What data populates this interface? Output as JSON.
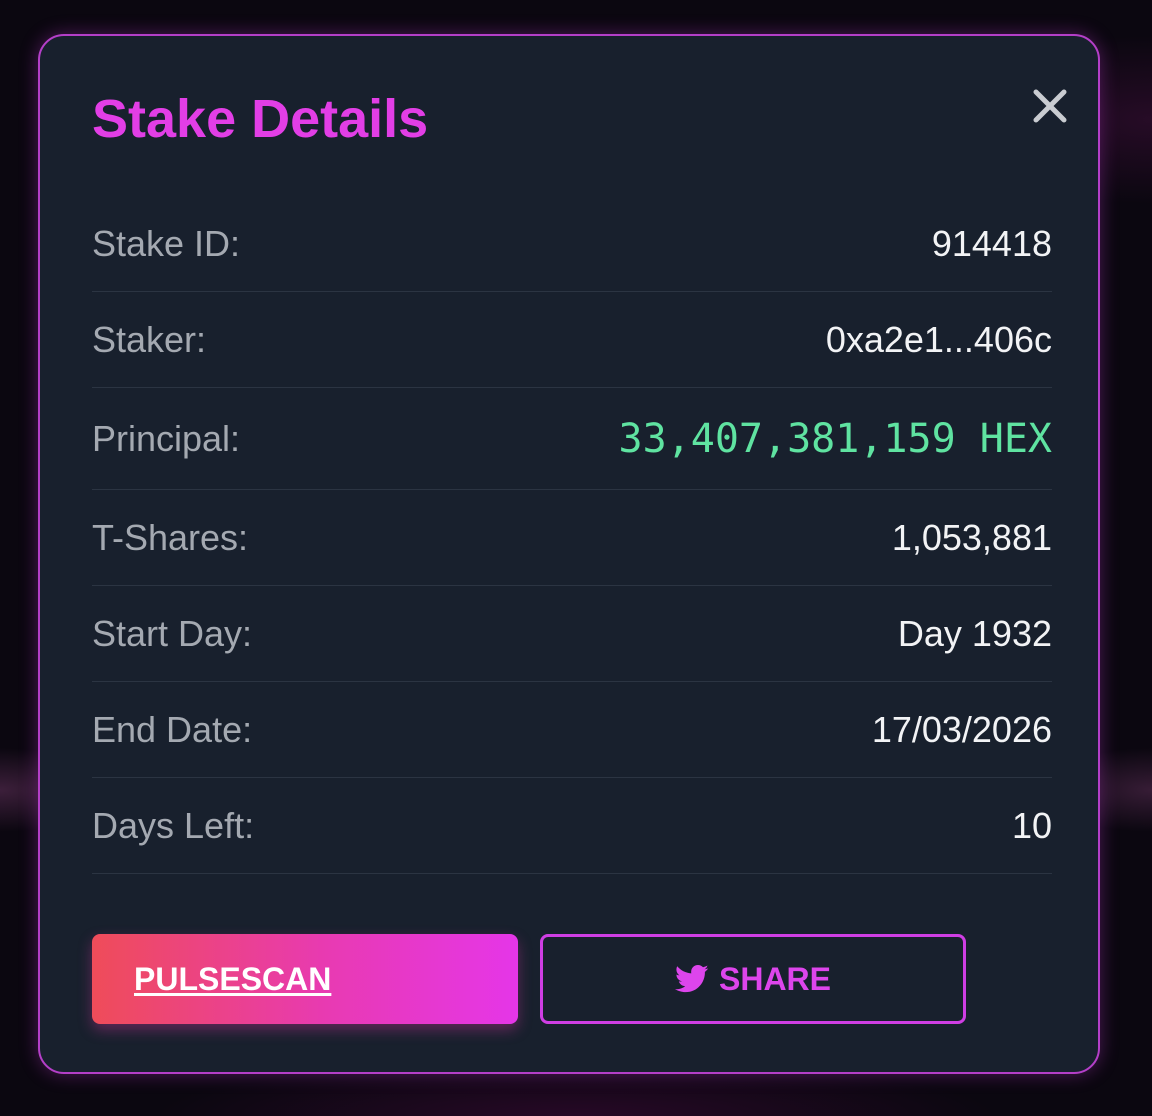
{
  "colors": {
    "accent": "#e23ee6",
    "principal_green": "#5fe3a1",
    "panel_bg": "#18202d",
    "border": "#b43fc8"
  },
  "modal": {
    "title": "Stake Details",
    "close_icon": "close-icon"
  },
  "details": [
    {
      "label": "Stake ID:",
      "value": "914418"
    },
    {
      "label": "Staker:",
      "value": "0xa2e1...406c"
    },
    {
      "label": "Principal:",
      "value": "33,407,381,159 HEX"
    },
    {
      "label": "T-Shares:",
      "value": "1,053,881"
    },
    {
      "label": "Start Day:",
      "value": "Day 1932"
    },
    {
      "label": "End Date:",
      "value": "17/03/2026"
    },
    {
      "label": "Days Left:",
      "value": "10"
    }
  ],
  "actions": {
    "pulsescan_label": "PULSESCAN",
    "share_label": "SHARE",
    "share_icon": "twitter-icon"
  }
}
